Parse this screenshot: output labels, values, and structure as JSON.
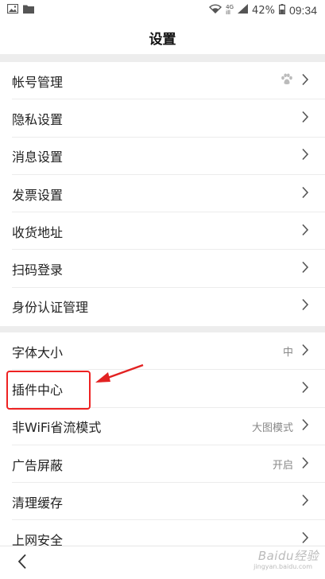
{
  "status_bar": {
    "network": "4G",
    "network_sub": "ill",
    "battery_percent": "42%",
    "time": "09:34"
  },
  "header": {
    "title": "设置"
  },
  "group1": [
    {
      "label": "帐号管理",
      "value": "",
      "icon": "paw-icon"
    },
    {
      "label": "隐私设置",
      "value": ""
    },
    {
      "label": "消息设置",
      "value": ""
    },
    {
      "label": "发票设置",
      "value": ""
    },
    {
      "label": "收货地址",
      "value": ""
    },
    {
      "label": "扫码登录",
      "value": ""
    },
    {
      "label": "身份认证管理",
      "value": ""
    }
  ],
  "group2": [
    {
      "label": "字体大小",
      "value": "中"
    },
    {
      "label": "插件中心",
      "value": ""
    },
    {
      "label": "非WiFi省流模式",
      "value": "大图模式"
    },
    {
      "label": "广告屏蔽",
      "value": "开启"
    },
    {
      "label": "清理缓存",
      "value": ""
    },
    {
      "label": "上网安全",
      "value": ""
    }
  ],
  "annotation": {
    "highlight_color": "#e22222"
  },
  "watermark": {
    "text": "Baidu经验",
    "sub": "jingyan.baidu.com"
  }
}
